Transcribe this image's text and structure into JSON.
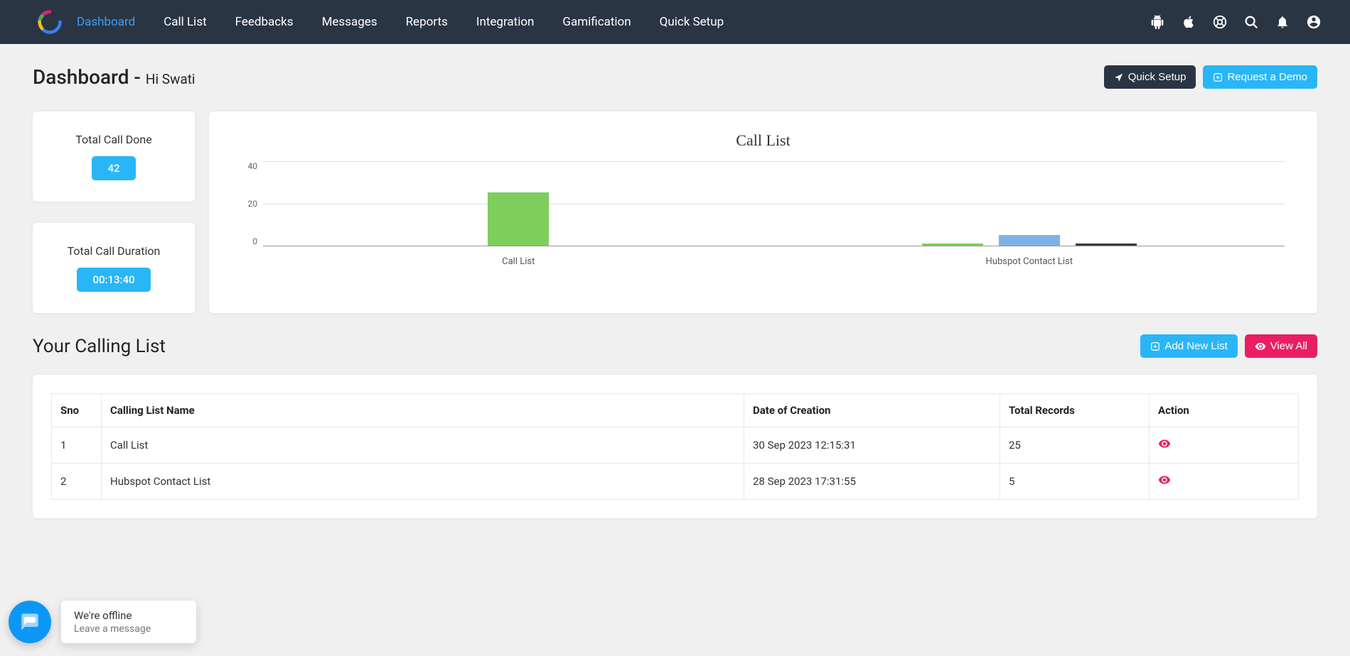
{
  "nav": {
    "items": [
      "Dashboard",
      "Call List",
      "Feedbacks",
      "Messages",
      "Reports",
      "Integration",
      "Gamification",
      "Quick Setup"
    ],
    "active_index": 0
  },
  "header": {
    "title": "Dashboard - ",
    "greeting": "Hi Swati",
    "quick_setup": "Quick Setup",
    "request_demo": "Request a Demo"
  },
  "stats": {
    "total_call_done": {
      "label": "Total Call Done",
      "value": "42"
    },
    "total_call_duration": {
      "label": "Total Call Duration",
      "value": "00:13:40"
    }
  },
  "chart_data": {
    "type": "bar",
    "title": "Call List",
    "categories": [
      "Call List",
      "Hubspot Contact List"
    ],
    "series": [
      {
        "name": "Green",
        "color": "#7dce5c",
        "values": [
          25,
          1
        ]
      },
      {
        "name": "Blue",
        "color": "#7fb1e6",
        "values": [
          0,
          5
        ]
      },
      {
        "name": "Dark",
        "color": "#3a3a3a",
        "values": [
          0,
          1
        ]
      }
    ],
    "ylim": [
      0,
      40
    ],
    "yticks": [
      40,
      20,
      0
    ]
  },
  "calling_list": {
    "title": "Your Calling List",
    "add_new": "Add New List",
    "view_all": "View All",
    "columns": [
      "Sno",
      "Calling List Name",
      "Date of Creation",
      "Total Records",
      "Action"
    ],
    "rows": [
      {
        "sno": "1",
        "name": "Call List",
        "date": "30 Sep 2023 12:15:31",
        "records": "25"
      },
      {
        "sno": "2",
        "name": "Hubspot Contact List",
        "date": "28 Sep 2023 17:31:55",
        "records": "5"
      }
    ]
  },
  "chat": {
    "line1": "We're offline",
    "line2": "Leave a message"
  }
}
